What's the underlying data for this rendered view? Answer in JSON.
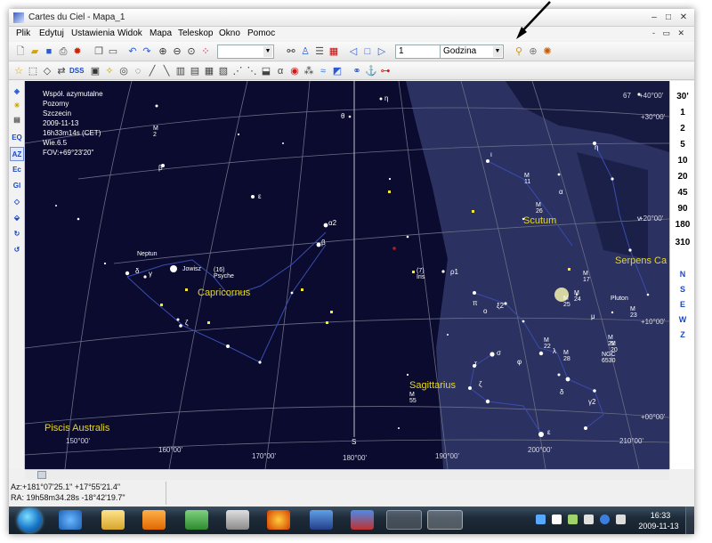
{
  "window": {
    "title": "Cartes du Ciel - Mapa_1",
    "minimize": "–",
    "maximize": "□",
    "close": "✕"
  },
  "menu": [
    "Plik",
    "Edytuj",
    "Ustawienia",
    "Widok",
    "Mapa",
    "Teleskop",
    "Okno",
    "Pomoc"
  ],
  "mdi_controls": "- ▭ ✕",
  "toolbar": {
    "step_value": "1",
    "time_unit": "Godzina",
    "dss_label": "DSS"
  },
  "left_toolbar": [
    "EQ",
    "AZ",
    "Ec",
    "Gl"
  ],
  "info": {
    "projection": "Współ. azymutalne",
    "mode": "Pozorny",
    "location": "Szczecin",
    "date": "2009-11-13",
    "time": "16h33m14s (CET)",
    "magnitude": "Wie.6.5",
    "fov": "FOV:+69°23'20\""
  },
  "sky": {
    "constellations": [
      "Capricornus",
      "Scutum",
      "Serpens Ca",
      "Sagittarius",
      "Piscis Australis"
    ],
    "bottom_labels": [
      "150°00'",
      "160°00'",
      "170°00'",
      "180°00'",
      "190°00'",
      "200°00'",
      "210°00'"
    ],
    "south_label": "S",
    "right_labels": [
      "+30°00'",
      "+20°00'",
      "+10°00'",
      "+00°00'"
    ],
    "top_right_label": "+40°00'",
    "top_right_value": "67",
    "objects": [
      {
        "label": "M 2"
      },
      {
        "label": "Neptun"
      },
      {
        "label": "Jowisz"
      },
      {
        "label": "(16) Psyche"
      },
      {
        "label": "(7) Iris"
      },
      {
        "label": "M 11"
      },
      {
        "label": "M 26"
      },
      {
        "label": "M 17"
      },
      {
        "label": "M 25"
      },
      {
        "label": "M 24"
      },
      {
        "label": "Pluton"
      },
      {
        "label": "M 23"
      },
      {
        "label": "M 22"
      },
      {
        "label": "M 28"
      },
      {
        "label": "M 21"
      },
      {
        "label": "M 20"
      },
      {
        "label": "NGC 6530"
      },
      {
        "label": "M 55"
      }
    ],
    "greek": [
      "η",
      "θ",
      "β",
      "ε",
      "α2",
      "β",
      "δ",
      "γ",
      "ζ",
      "ρ1",
      "π",
      "o",
      "ξ2",
      "σ",
      "τ",
      "ζ",
      "φ",
      "λ",
      "μ",
      "δ",
      "γ2",
      "ε",
      "α",
      "ν",
      "η",
      "ι"
    ]
  },
  "fov_buttons": [
    "30'",
    "1",
    "2",
    "5",
    "10",
    "20",
    "45",
    "90",
    "180",
    "310"
  ],
  "direction_buttons": [
    "N",
    "S",
    "E",
    "W",
    "Z"
  ],
  "status": {
    "azalt": "Az:+181°07'25.1\" +17°55'21.4\"",
    "radec": "RA: 19h58m34.28s -18°42'19.7\""
  },
  "taskbar": {
    "time": "16:33",
    "date": "2009-11-13"
  }
}
